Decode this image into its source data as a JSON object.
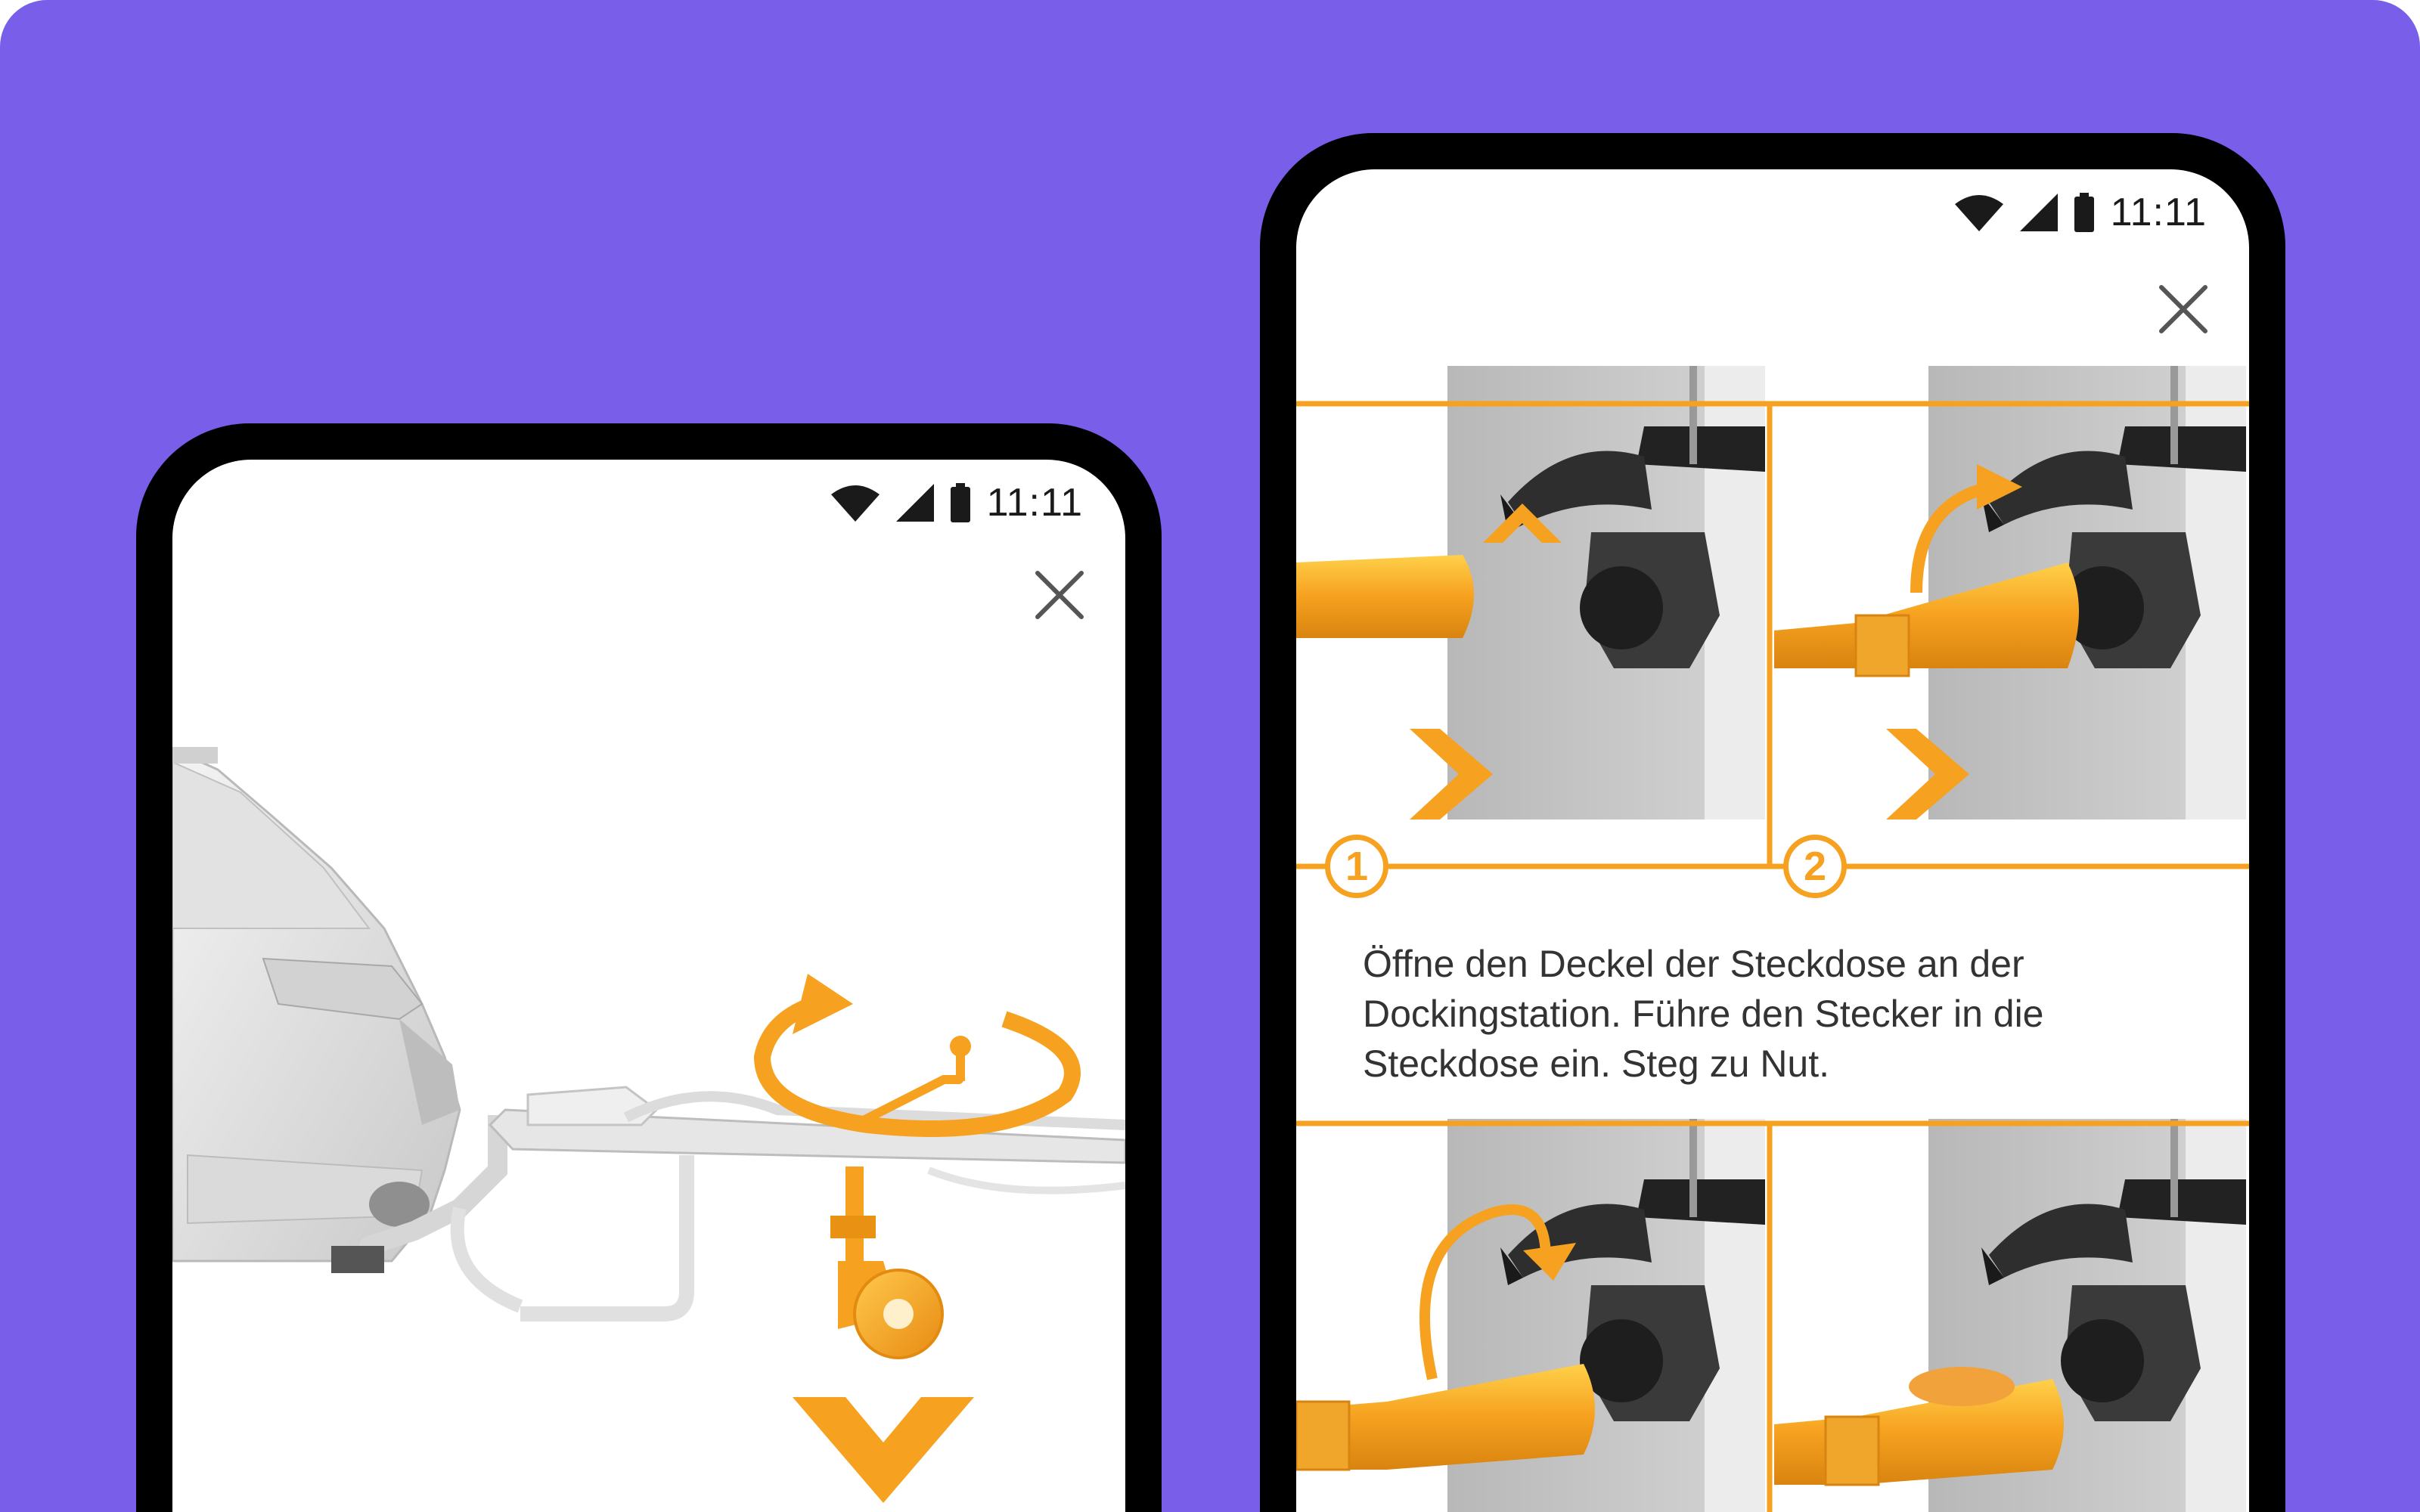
{
  "colors": {
    "background": "#785ee9",
    "accent": "#f6a11f",
    "device_frame": "#000000",
    "screen": "#ffffff"
  },
  "left_phone": {
    "status_bar": {
      "time": "11:11",
      "icons": [
        "wifi-icon",
        "signal-icon",
        "battery-icon"
      ]
    },
    "close_icon": "close-icon",
    "illustration": "car-trailer-jockey-wheel",
    "arrows": [
      "rotate-arrow-icon",
      "chevron-down-icon"
    ]
  },
  "right_phone": {
    "status_bar": {
      "time": "11:11",
      "icons": [
        "wifi-icon",
        "signal-icon",
        "battery-icon"
      ]
    },
    "close_icon": "close-icon",
    "steps": [
      {
        "number": "1"
      },
      {
        "number": "2"
      }
    ],
    "instruction": "Öffne den Deckel der Steckdose an der Dockingstation. Führe den Stecker in die Steckdose ein. Steg zu Nut."
  }
}
